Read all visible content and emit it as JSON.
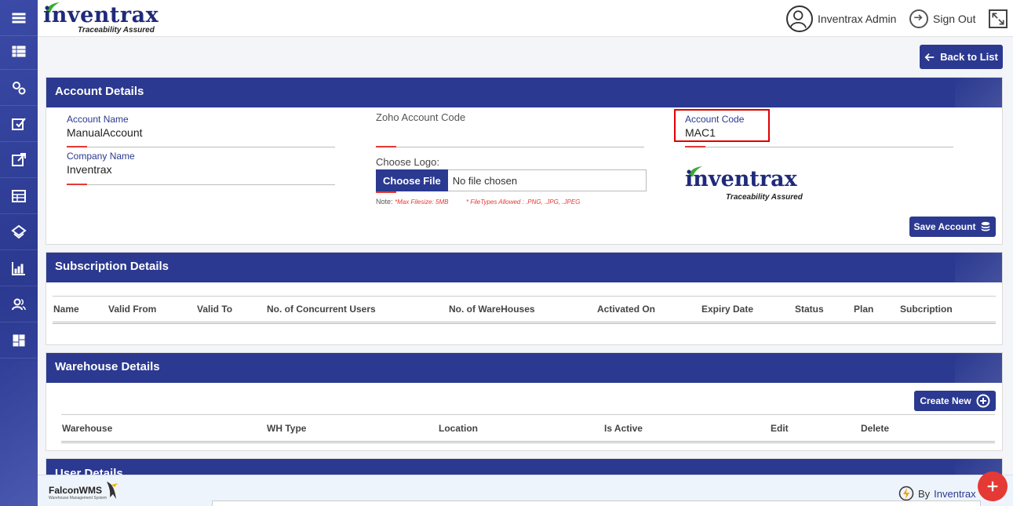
{
  "header": {
    "logo_text": "inventrax",
    "logo_tagline": "Traceability Assured",
    "user_name": "Inventrax Admin",
    "signout_label": "Sign Out"
  },
  "toolbar": {
    "back_label": "Back to List"
  },
  "account": {
    "title": "Account Details",
    "account_name_label": "Account Name",
    "account_name_value": "ManualAccount",
    "zoho_label": "Zoho Account Code",
    "zoho_value": "",
    "account_code_label": "Account Code",
    "account_code_value": "MAC1",
    "company_name_label": "Company Name",
    "company_name_value": "Inventrax",
    "choose_logo_label": "Choose Logo:",
    "choose_file_label": "Choose File",
    "no_file_label": "No file chosen",
    "note_prefix": "Note:",
    "note_max": "*Max Filesize: 5MB",
    "note_types": "* FileTypes Allowed : .PNG, .JPG, .JPEG",
    "preview_logo_text": "inventrax",
    "preview_logo_tagline": "Traceability Assured",
    "save_label": "Save Account"
  },
  "subscription": {
    "title": "Subscription Details",
    "columns": [
      "Name",
      "Valid From",
      "Valid To",
      "No. of Concurrent Users",
      "No. of WareHouses",
      "Activated On",
      "Expiry Date",
      "Status",
      "Plan",
      "Subcription"
    ]
  },
  "warehouse": {
    "title": "Warehouse Details",
    "create_label": "Create New",
    "columns": [
      "Warehouse",
      "WH Type",
      "Location",
      "Is Active",
      "Edit",
      "Delete"
    ]
  },
  "user_details": {
    "title": "User Details"
  },
  "footer": {
    "falcon_label": "FalconWMS",
    "falcon_sub": "Warehouse Management System",
    "by_label": "By",
    "brand": "Inventrax"
  },
  "colors": {
    "primary": "#2b3990",
    "accent": "#e53935",
    "highlight": "#e00000"
  },
  "icons": {
    "sidebar": [
      "menu-icon",
      "list-icon",
      "settings-icon",
      "checkbox-edit-icon",
      "external-link-icon",
      "table-icon",
      "layers-icon",
      "chart-icon",
      "users-icon",
      "dashboard-icon"
    ]
  }
}
